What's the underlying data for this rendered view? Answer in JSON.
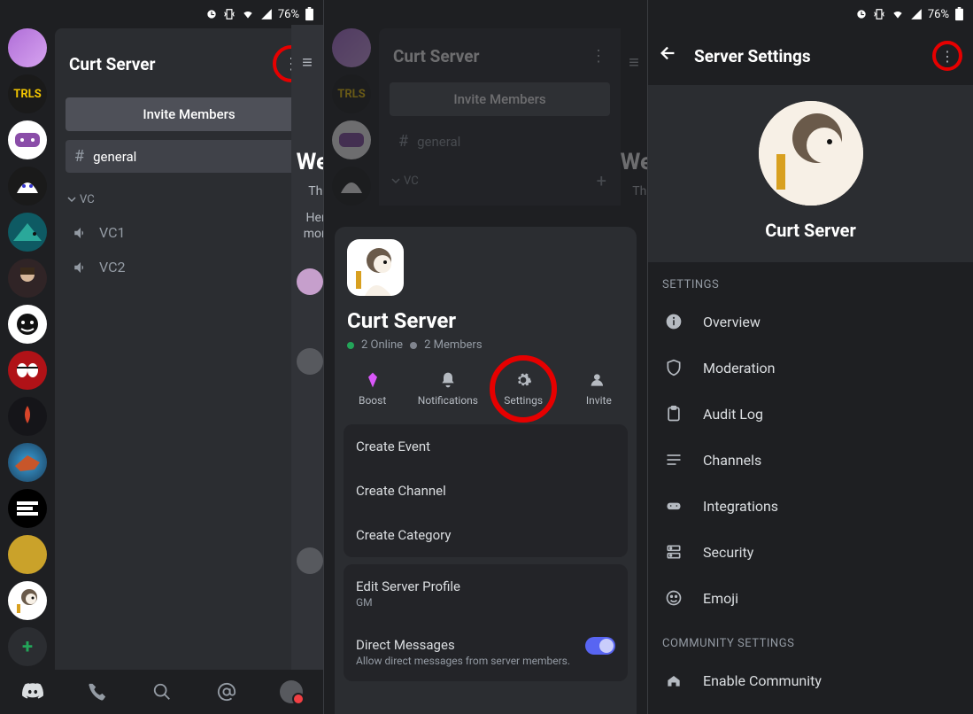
{
  "statusbar": {
    "battery": "76%"
  },
  "panel1": {
    "server_title": "Curt Server",
    "invite_label": "Invite Members",
    "text_channels": [
      {
        "name": "general"
      }
    ],
    "voice_category": "vc",
    "voice_channels": [
      {
        "name": "VC1"
      },
      {
        "name": "VC2"
      }
    ],
    "rail_labels": {
      "trls": "TRLS"
    },
    "peek": {
      "welcome_frag": "We",
      "this_frag": "This",
      "here_frag": "Here",
      "more_frag": "more"
    }
  },
  "panel2": {
    "dim_server_title": "Curt Server",
    "dim_invite": "Invite Members",
    "dim_general": "general",
    "dim_vc": "vc",
    "dim_rail_trls": "TRLS",
    "dim_peek_we": "We",
    "dim_peek_this": "This",
    "sheet": {
      "title": "Curt Server",
      "online_count": "2 Online",
      "member_count": "2 Members",
      "actions": {
        "boost": "Boost",
        "notifications": "Notifications",
        "settings": "Settings",
        "invite": "Invite"
      },
      "group1": [
        "Create Event",
        "Create Channel",
        "Create Category"
      ],
      "profile_label": "Edit Server Profile",
      "profile_sub": "GM",
      "dm_label": "Direct Messages",
      "dm_sub": "Allow direct messages from server members."
    }
  },
  "panel3": {
    "header_title": "Server Settings",
    "server_name": "Curt Server",
    "section_settings": "SETTINGS",
    "rows_settings": [
      "Overview",
      "Moderation",
      "Audit Log",
      "Channels",
      "Integrations",
      "Security",
      "Emoji"
    ],
    "section_community": "COMMUNITY SETTINGS",
    "rows_community": [
      "Enable Community"
    ]
  }
}
